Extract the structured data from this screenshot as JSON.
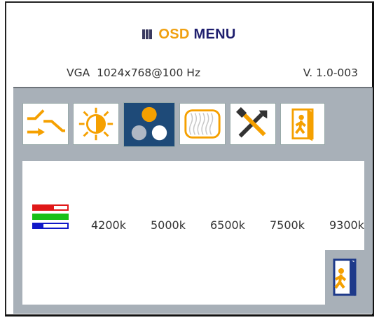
{
  "header": {
    "logo_icon": "bars-logo-icon",
    "title_osd": "OSD",
    "title_menu": "MENU",
    "osd_color": "#f0a010",
    "menu_color": "#1e1e6e"
  },
  "status": {
    "signal": "VGA  1024x768@100 Hz",
    "version": "V. 1.0-003"
  },
  "tabs": [
    {
      "icon": "input-switch-icon",
      "active": false
    },
    {
      "icon": "brightness-contrast-icon",
      "active": false
    },
    {
      "icon": "color-icon",
      "active": true
    },
    {
      "icon": "image-wave-icon",
      "active": false
    },
    {
      "icon": "tools-icon",
      "active": false
    },
    {
      "icon": "exit-door-icon",
      "active": false
    }
  ],
  "color": {
    "rgb_icon": "rgb-bars-icon",
    "temperatures": [
      "4200k",
      "5000k",
      "6500k",
      "7500k",
      "9300k"
    ]
  },
  "exit_icon": "exit-door-icon",
  "colors": {
    "panel": "#a8b0b8",
    "active_tab": "#1e4a78",
    "icon_orange": "#f5a000"
  }
}
